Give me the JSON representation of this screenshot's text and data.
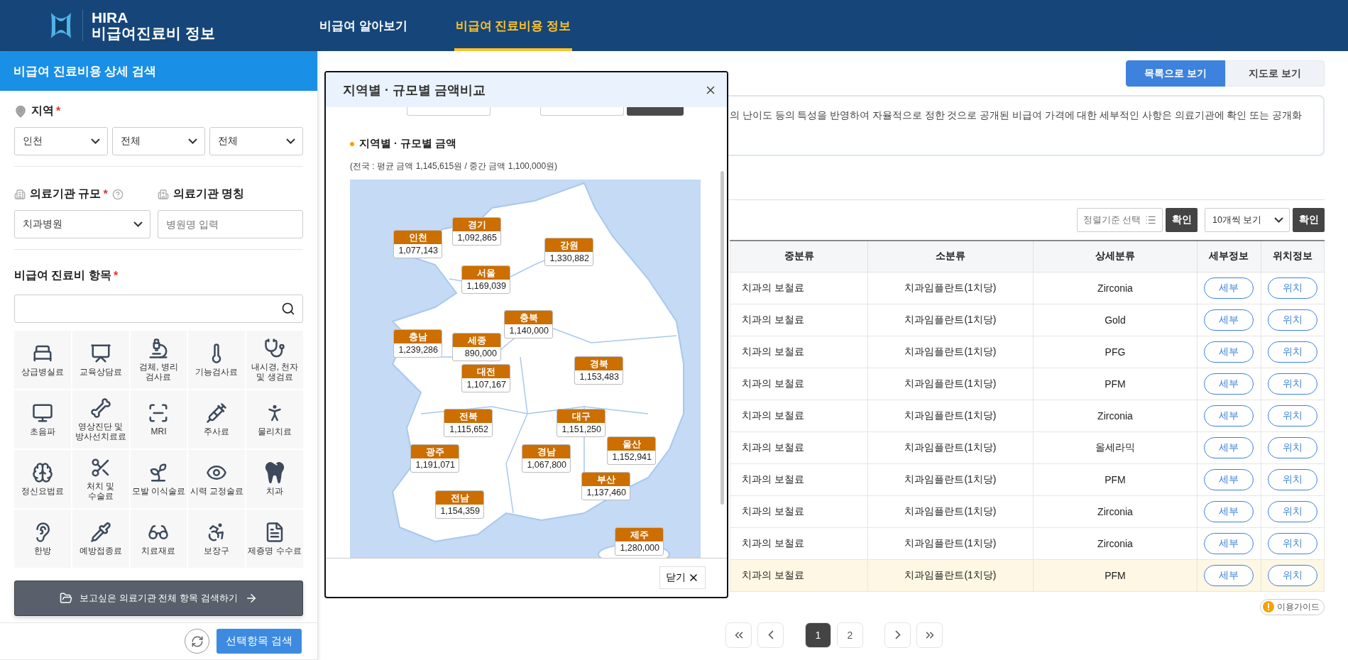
{
  "header": {
    "logo": {
      "line1": "HIRA",
      "line2": "비급여진료비 정보"
    },
    "nav": [
      {
        "label": "비급여 알아보기",
        "selected": false
      },
      {
        "label": "비급여 진료비용 정보",
        "selected": true
      }
    ]
  },
  "sidebar": {
    "title": "비급여 진료비용 상세 검색",
    "region": {
      "label": "지역",
      "mark": "*",
      "selects": [
        "인천",
        "전체",
        "전체"
      ]
    },
    "facility": {
      "size_label": "의료기관 규모",
      "size_mark": "*",
      "size_value": "치과병원",
      "name_label": "의료기관 명칭",
      "name_placeholder": "병원명 입력"
    },
    "items": {
      "label": "비급여 진료비 항목",
      "mark": "*"
    },
    "categories": [
      "상급병실료",
      "교육상담료",
      "검체, 병리 검사료",
      "기능검사료",
      "내시경, 천자 및 생검료",
      "초음파",
      "영상진단 및 방사선치료료",
      "MRI",
      "주사료",
      "물리치료",
      "정신요법료",
      "처치 및 수술료",
      "모발 이식술료",
      "시력 교정술료",
      "치과",
      "한방",
      "예방접종료",
      "치료재료",
      "보장구",
      "제증명 수수료"
    ],
    "all_button": "보고싶은 의료기관 전체 항목 검색하기",
    "search_button": "선택항목 검색"
  },
  "main": {
    "view_toggle": [
      {
        "label": "목록으로 보기",
        "selected": true
      },
      {
        "label": "지도로 보기",
        "selected": false
      }
    ],
    "notice": "의 난이도 등의 특성을 반영하여 자율적으로 정한 것으로 공개된 비급여 가격에 대한 세부적인 사항은 의료기관에 확인 또는 공개화",
    "sort": {
      "placeholder": "정렬기준 선택",
      "confirm": "확인",
      "page_size": "10개씩 보기",
      "page_confirm": "확인"
    },
    "table": {
      "columns": [
        "중분류",
        "소분류",
        "상세분류",
        "세부정보",
        "위치정보"
      ],
      "rows": [
        {
          "cells": [
            "치과의 보철료",
            "치과임플란트(1치당)",
            "Zirconia"
          ],
          "detail": "세부",
          "location": "위치",
          "selected": false
        },
        {
          "cells": [
            "치과의 보철료",
            "치과임플란트(1치당)",
            "Gold"
          ],
          "detail": "세부",
          "location": "위치",
          "selected": false
        },
        {
          "cells": [
            "치과의 보철료",
            "치과임플란트(1치당)",
            "PFG"
          ],
          "detail": "세부",
          "location": "위치",
          "selected": false
        },
        {
          "cells": [
            "치과의 보철료",
            "치과임플란트(1치당)",
            "PFM"
          ],
          "detail": "세부",
          "location": "위치",
          "selected": false
        },
        {
          "cells": [
            "치과의 보철료",
            "치과임플란트(1치당)",
            "Zirconia"
          ],
          "detail": "세부",
          "location": "위치",
          "selected": false
        },
        {
          "cells": [
            "치과의 보철료",
            "치과임플란트(1치당)",
            "올세라믹"
          ],
          "detail": "세부",
          "location": "위치",
          "selected": false
        },
        {
          "cells": [
            "치과의 보철료",
            "치과임플란트(1치당)",
            "PFM"
          ],
          "detail": "세부",
          "location": "위치",
          "selected": false
        },
        {
          "cells": [
            "치과의 보철료",
            "치과임플란트(1치당)",
            "Zirconia"
          ],
          "detail": "세부",
          "location": "위치",
          "selected": false
        },
        {
          "cells": [
            "치과의 보철료",
            "치과임플란트(1치당)",
            "Zirconia"
          ],
          "detail": "세부",
          "location": "위치",
          "selected": false
        },
        {
          "cells": [
            "치과의 보철료",
            "치과임플란트(1치당)",
            "PFM"
          ],
          "detail": "세부",
          "location": "위치",
          "selected": true
        }
      ]
    },
    "guide": "이용가이드",
    "pages": [
      {
        "label": "1",
        "selected": true
      },
      {
        "label": "2",
        "selected": false
      }
    ]
  },
  "modal": {
    "title": "지역별 · 규모별 금액비교",
    "section_title": "지역별 · 규모별 금액",
    "note": "(전국 : 평균 금액 1,145,615원 / 중간 금액 1,100,000원)",
    "regions": [
      {
        "name": "인천",
        "value": "1,077,143"
      },
      {
        "name": "경기",
        "value": "1,092,865"
      },
      {
        "name": "강원",
        "value": "1,330,882"
      },
      {
        "name": "서울",
        "value": "1,169,039"
      },
      {
        "name": "충북",
        "value": "1,140,000"
      },
      {
        "name": "충남",
        "value": "1,239,286"
      },
      {
        "name": "세종",
        "value": "890,000"
      },
      {
        "name": "대전",
        "value": "1,107,167"
      },
      {
        "name": "경북",
        "value": "1,153,483"
      },
      {
        "name": "전북",
        "value": "1,115,652"
      },
      {
        "name": "대구",
        "value": "1,151,250"
      },
      {
        "name": "울산",
        "value": "1,152,941"
      },
      {
        "name": "광주",
        "value": "1,191,071"
      },
      {
        "name": "경남",
        "value": "1,067,800"
      },
      {
        "name": "부산",
        "value": "1,137,460"
      },
      {
        "name": "전남",
        "value": "1,154,359"
      },
      {
        "name": "제주",
        "value": "1,280,000"
      }
    ],
    "close_button": "닫기"
  }
}
